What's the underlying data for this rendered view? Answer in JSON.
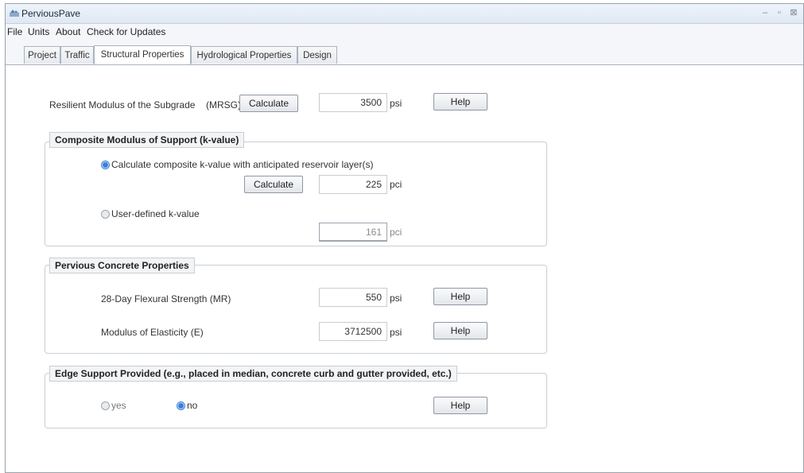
{
  "window": {
    "title": "PerviousPave",
    "controls": [
      "–",
      "▫",
      "⊠"
    ]
  },
  "menu": [
    "File",
    "Units",
    "About",
    "Check for Updates"
  ],
  "tabs": [
    {
      "label": "Project"
    },
    {
      "label": "Traffic"
    },
    {
      "label": "Structural Properties",
      "active": true
    },
    {
      "label": "Hydrological Properties"
    },
    {
      "label": "Design"
    }
  ],
  "subgrade": {
    "label": "Resilient Modulus of the Subgrade",
    "abbr": "(MRSG)",
    "calculate_label": "Calculate",
    "value": "3500",
    "unit": "psi",
    "help_label": "Help"
  },
  "composite": {
    "title": "Composite Modulus of Support (k-value)",
    "option_calc_label": "Calculate composite k-value with anticipated reservoir layer(s)",
    "option_calc_selected": true,
    "calculate_label": "Calculate",
    "calc_value": "225",
    "calc_unit": "pci",
    "option_user_label": "User-defined k-value",
    "option_user_selected": false,
    "user_value": "161",
    "user_unit": "pci"
  },
  "concrete": {
    "title": "Pervious Concrete Properties",
    "flexural_label": "28-Day Flexural Strength (MR)",
    "flexural_value": "550",
    "flexural_unit": "psi",
    "modulus_label": "Modulus of Elasticity (E)",
    "modulus_value": "3712500",
    "modulus_unit": "psi",
    "help_label": "Help"
  },
  "edge": {
    "title": "Edge Support Provided (e.g., placed in median, concrete curb and gutter provided, etc.)",
    "yes_label": "yes",
    "no_label": "no",
    "selected": "no",
    "help_label": "Help"
  },
  "colors": {
    "accent": "#3b7fd9",
    "titlebar": "#dfe8f3"
  }
}
